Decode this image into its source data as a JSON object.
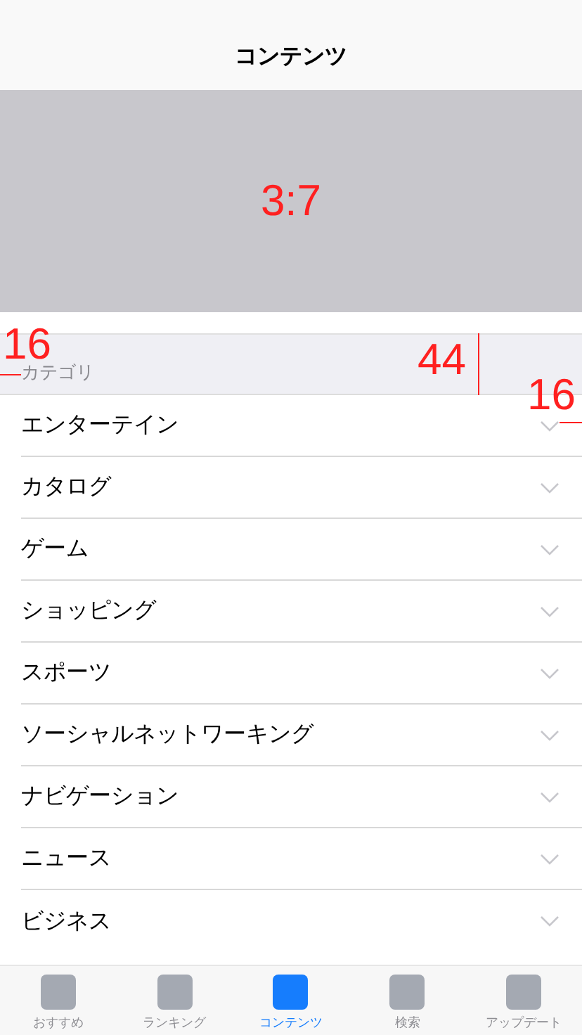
{
  "nav_bar": {
    "title": "コンテンツ"
  },
  "banner": {
    "annotation": "3:7"
  },
  "section": {
    "header": "カテゴリ"
  },
  "rows": [
    {
      "label": "エンターテイン",
      "expanded": false
    },
    {
      "label": "カタログ",
      "expanded": false
    },
    {
      "label": "ゲーム",
      "expanded": false
    },
    {
      "label": "ショッピング",
      "expanded": false
    },
    {
      "label": "スポーツ",
      "expanded": false
    },
    {
      "label": "ソーシャルネットワーキング",
      "expanded": false
    },
    {
      "label": "ナビゲーション",
      "expanded": false
    },
    {
      "label": "ニュース",
      "expanded": false
    },
    {
      "label": "ビジネス",
      "expanded": false
    }
  ],
  "annotations": [
    {
      "kind": "left-inset",
      "text": "16"
    },
    {
      "kind": "height",
      "text": "44"
    },
    {
      "kind": "right-inset",
      "text": "16"
    }
  ],
  "tab_bar": [
    {
      "label": "おすすめ",
      "selected": false
    },
    {
      "label": "ランキング",
      "selected": false
    },
    {
      "label": "コンテンツ",
      "selected": true
    },
    {
      "label": "検索",
      "selected": false
    },
    {
      "label": "アップデート",
      "selected": false
    }
  ]
}
